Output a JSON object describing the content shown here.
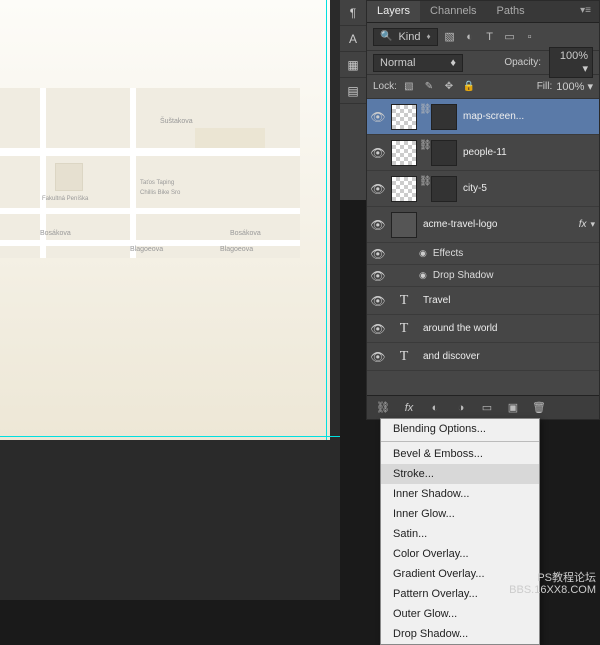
{
  "panel": {
    "tabs": [
      "Layers",
      "Channels",
      "Paths"
    ],
    "active_tab": "Layers",
    "filter_label": "Kind",
    "blend_mode": "Normal",
    "opacity_label": "Opacity:",
    "opacity_value": "100%",
    "lock_label": "Lock:",
    "fill_label": "Fill:",
    "fill_value": "100%"
  },
  "layers": [
    {
      "name": "map-screen...",
      "type": "smart",
      "selected": true,
      "visible": true
    },
    {
      "name": "people-11",
      "type": "smart",
      "selected": false,
      "visible": true
    },
    {
      "name": "city-5",
      "type": "smart",
      "selected": false,
      "visible": true
    },
    {
      "name": "acme-travel-logo",
      "type": "smart",
      "selected": false,
      "visible": true,
      "fx": true,
      "effects": [
        "Effects",
        "Drop Shadow"
      ]
    },
    {
      "name": "Travel",
      "type": "text",
      "visible": true
    },
    {
      "name": "around the world",
      "type": "text",
      "visible": true
    },
    {
      "name": "and discover",
      "type": "text",
      "visible": true
    }
  ],
  "map_labels": {
    "l1": "Šuštakova",
    "l2": "Bosákova",
    "l3": "Bosákova",
    "l4": "Blagoeova",
    "l5": "Blagoeova",
    "l6": "Fakultná Peníška",
    "l7": "Taťos Taping",
    "l8": "Chillis Bike Sro"
  },
  "fx_menu": {
    "items": [
      "Blending Options...",
      "---",
      "Bevel & Emboss...",
      "Stroke...",
      "Inner Shadow...",
      "Inner Glow...",
      "Satin...",
      "Color Overlay...",
      "Gradient Overlay...",
      "Pattern Overlay...",
      "Outer Glow...",
      "Drop Shadow..."
    ],
    "highlighted": "Stroke..."
  },
  "watermark": {
    "line1": "PS教程论坛",
    "line2": "BBS.16XX8.COM"
  }
}
